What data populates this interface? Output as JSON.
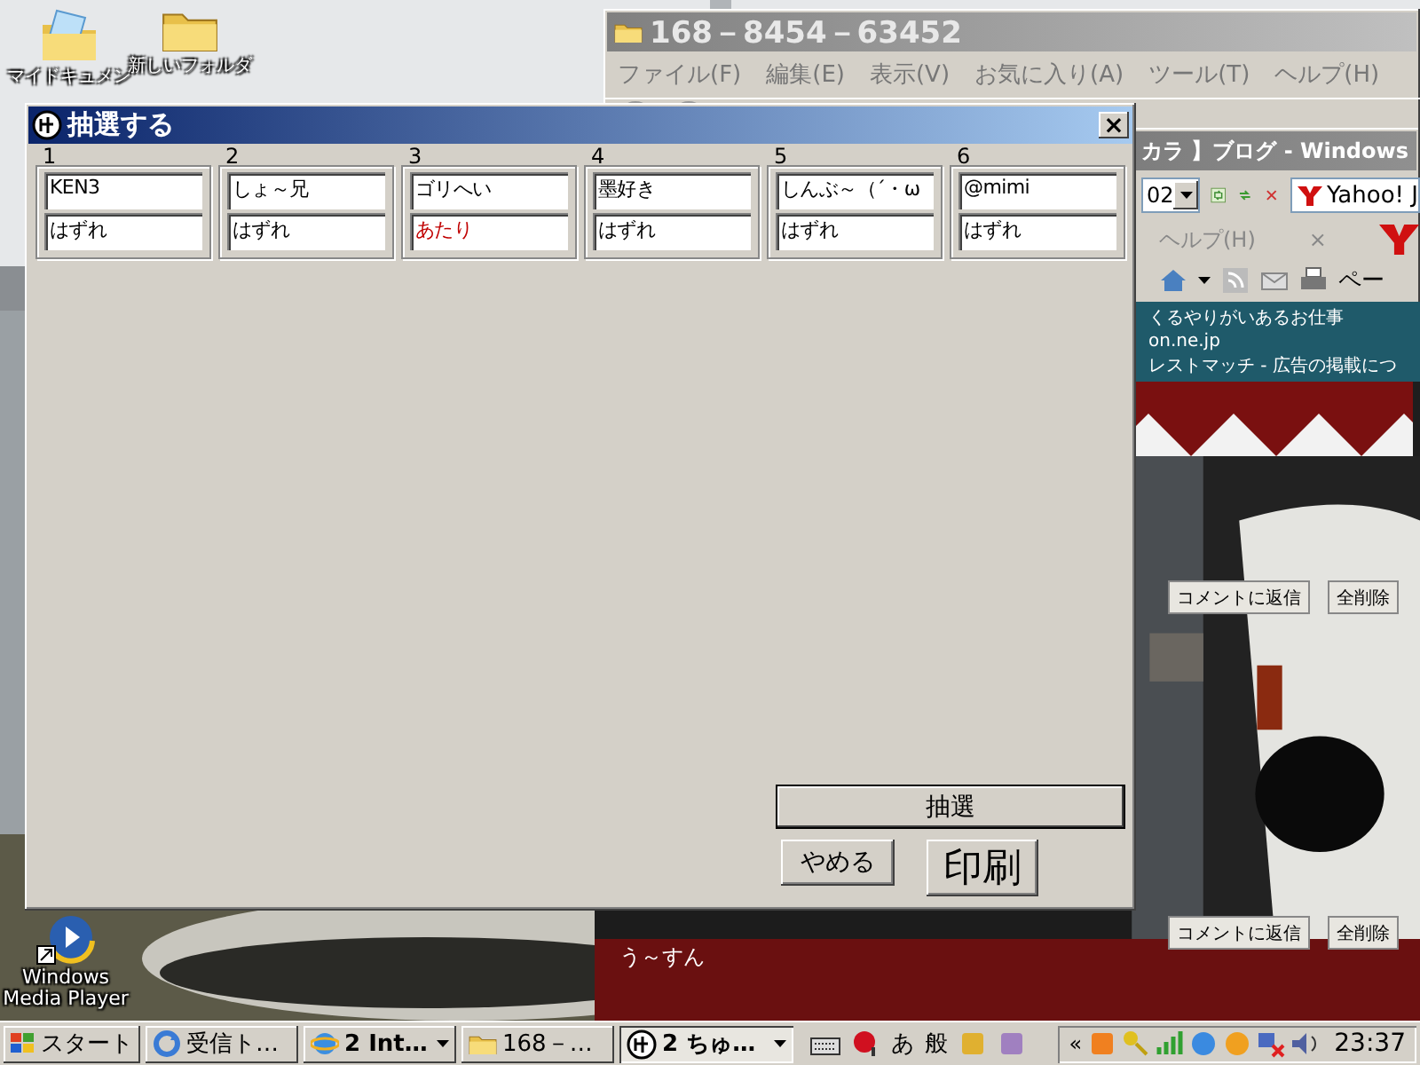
{
  "desktop": {
    "icons": [
      {
        "kind": "documents",
        "label": "マイドキュメン"
      },
      {
        "kind": "folder",
        "label": "新しいフォルダ"
      },
      {
        "kind": "media-player",
        "label": "Windows Media Player"
      }
    ]
  },
  "explorer_window": {
    "title": "168－8454－63452",
    "menu": [
      "ファイル(F)",
      "編集(E)",
      "表示(V)",
      "お気に入り(A)",
      "ツール(T)",
      "ヘルプ(H)"
    ]
  },
  "browser_window": {
    "title": "カラ 】ブログ - Windows",
    "address_fragment": "02",
    "search": "Yahoo! J",
    "menu_fragment": "ヘルプ(H)",
    "menu_close": "×",
    "command_fragment": "ペー",
    "links": [
      "くるやりがいあるお仕事",
      "on.ne.jp",
      "レストマッチ - 広告の掲載につ"
    ],
    "comments": [
      {
        "reply_button": "コメントに返信",
        "delete_button": "全削除"
      },
      {
        "reply_button": "コメントに返信",
        "delete_button": "全削除"
      }
    ],
    "author": "う～すん"
  },
  "dialog": {
    "title": "抽選する",
    "close": "×",
    "entries": [
      {
        "number": "1",
        "name": "KEN3",
        "result": "はずれ",
        "kind": "miss"
      },
      {
        "number": "2",
        "name": "しょ～兄",
        "result": "はずれ",
        "kind": "miss"
      },
      {
        "number": "3",
        "name": "ゴリへい",
        "result": "あたり",
        "kind": "hit"
      },
      {
        "number": "4",
        "name": "墨好き",
        "result": "はずれ",
        "kind": "miss"
      },
      {
        "number": "5",
        "name": "しんぶ～（´・ω",
        "result": "はずれ",
        "kind": "miss"
      },
      {
        "number": "6",
        "name": "@mimi",
        "result": "はずれ",
        "kind": "miss"
      }
    ],
    "draw_button": "抽選",
    "cancel_button": "やめる",
    "print_button": "印刷"
  },
  "taskbar": {
    "start": "スタート",
    "tasks": [
      {
        "kind": "mail",
        "label": "受信ト…",
        "grouped": false,
        "selected": false
      },
      {
        "kind": "browser",
        "label": "2 Int…",
        "grouped": true,
        "selected": false
      },
      {
        "kind": "folder",
        "label": "168－…",
        "grouped": false,
        "selected": false
      },
      {
        "kind": "app",
        "label": "2 ちゅ…",
        "grouped": true,
        "selected": true
      }
    ],
    "ime": [
      "あ",
      "般"
    ],
    "expand": "«",
    "clock": "23:37"
  }
}
